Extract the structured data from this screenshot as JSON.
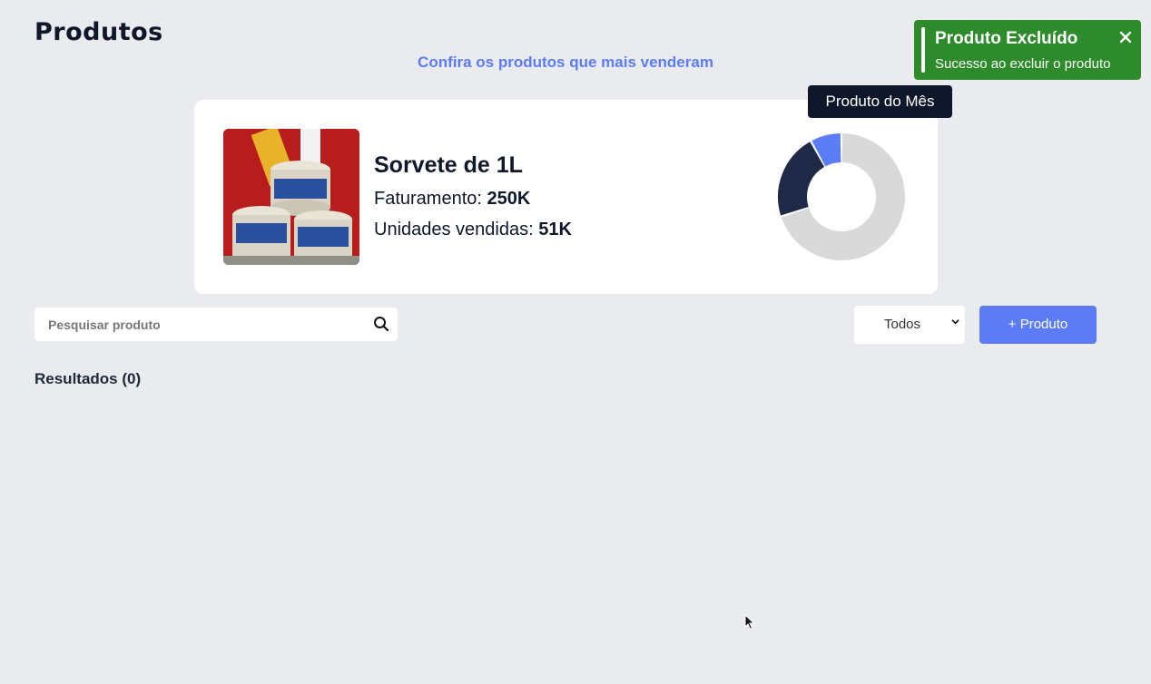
{
  "header": {
    "title": "Produtos",
    "subtitle": "Confira os produtos que mais venderam"
  },
  "featured": {
    "name": "Sorvete de 1L",
    "revenue_label": "Faturamento: ",
    "revenue_value": "250K",
    "units_label": "Unidades vendidas: ",
    "units_value": "51K",
    "tooltip": "Produto do Mês",
    "donut": {
      "segments": [
        {
          "share": 0.7,
          "color": "#d9d9d9"
        },
        {
          "share": 0.22,
          "color": "#1e2a48"
        },
        {
          "share": 0.08,
          "color": "#5b7cf5"
        }
      ]
    }
  },
  "toolbar": {
    "search_placeholder": "Pesquisar produto",
    "filter_value": "Todos",
    "add_label": "+ Produto"
  },
  "results": {
    "label": "Resultados (0)"
  },
  "toast": {
    "title": "Produto Excluído",
    "message": "Sucesso ao excluir o produto",
    "close_icon": "close-icon"
  },
  "colors": {
    "accent": "#5b7cf5",
    "success": "#2e8b2b",
    "dark": "#0f172a"
  }
}
